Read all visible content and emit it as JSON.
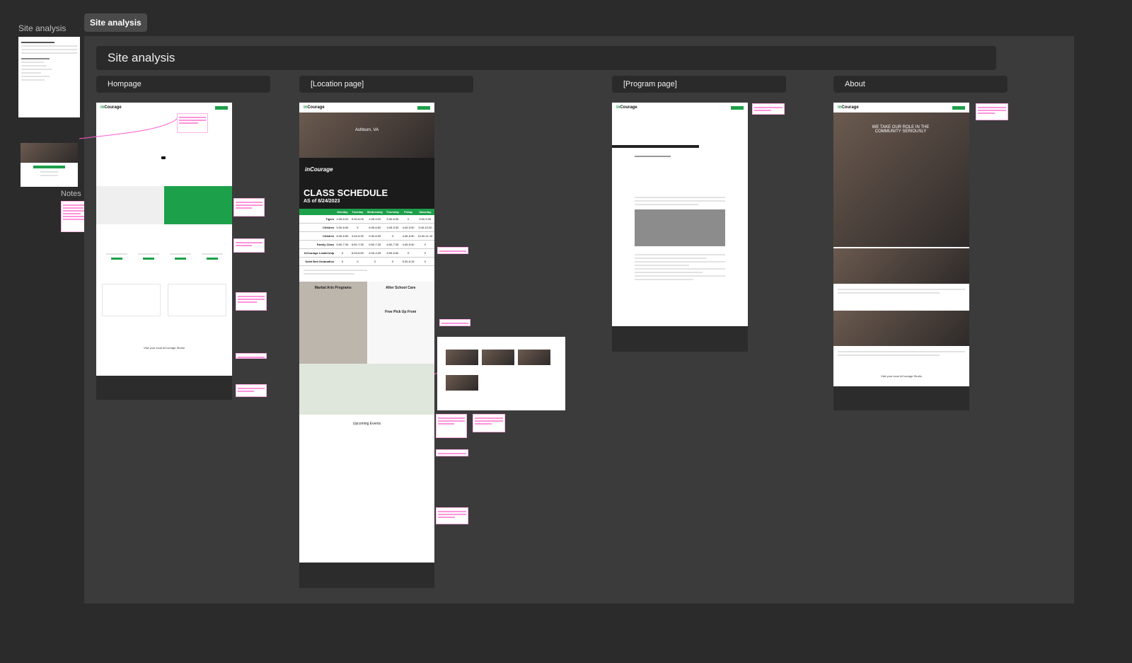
{
  "sidebar": {
    "page_label": "Site analysis",
    "notes_label": "Notes"
  },
  "board": {
    "tag": "Site analysis",
    "title": "Site analysis"
  },
  "columns": {
    "homepage": "Hompage",
    "location": "[Location page]",
    "program": "[Program page]",
    "about": "About"
  },
  "location_page": {
    "hero_city": "Ashburn, VA",
    "brand": "inCourage",
    "schedule_title": "CLASS SCHEDULE",
    "schedule_date": "AS of 8/24/2023",
    "days": [
      "Monday",
      "Tuesday",
      "Wednesday",
      "Thursday",
      "Friday",
      "Saturday"
    ],
    "rows": [
      {
        "name": "Tigers",
        "cells": [
          "4:45-5:20",
          "5:30-6:05",
          "4:45-5:20",
          "5:30-6:05",
          "X",
          "9:00-9:35"
        ]
      },
      {
        "name": "Children",
        "cells": [
          "5:30-6:05",
          "X",
          "6:05-6:50",
          "4:45-5:30",
          "4:45-5:30",
          "9:45-10:30"
        ]
      },
      {
        "name": "Children",
        "cells": [
          "6:05-6:50",
          "4:45-5:30",
          "5:30-6:05",
          "X",
          "4:45-5:30",
          "10:30-11:15"
        ]
      },
      {
        "name": "Family Class",
        "cells": [
          "6:50-7:35",
          "6:50-7:35",
          "6:50-7:35",
          "6:50-7:35",
          "4:45-5:30",
          "X"
        ]
      },
      {
        "name": "InCourage Leadership",
        "cells": [
          "X",
          "6:05-6:50",
          "4:00-4:45",
          "6:05-6:50",
          "X",
          "X"
        ]
      },
      {
        "name": "Solid Belt Graduation",
        "cells": [
          "X",
          "X",
          "X",
          "X",
          "5:30-6:15",
          "X"
        ]
      }
    ],
    "programs_title": "Martial Arts Programs",
    "after_school_title": "After School Care",
    "free_pickup": "Free Pick Up From",
    "events_title": "Upcoming Events"
  },
  "homepage": {
    "visit_text": "Visit your local InCourage Studio"
  },
  "about": {
    "hero_text": "WE TAKE OUR ROLE IN THE COMMUNITY SERIOUSLY",
    "visit_text": "Visit your local InCourage Studio"
  }
}
